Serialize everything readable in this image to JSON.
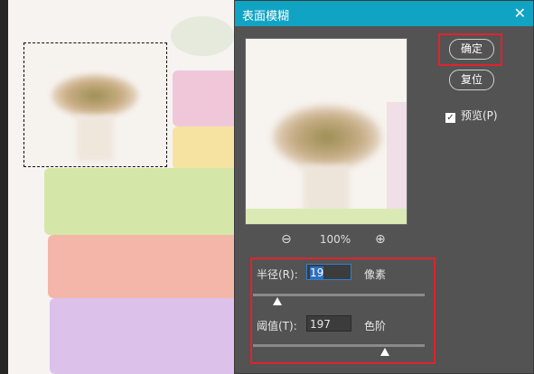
{
  "dialog": {
    "title": "表面模糊",
    "close_icon": "close-icon",
    "ok_label": "确定",
    "reset_label": "复位",
    "preview_label": "预览(P)",
    "preview_checked": true
  },
  "zoom": {
    "level": "100%",
    "zoom_out_icon": "zoom-out-icon",
    "zoom_in_icon": "zoom-in-icon"
  },
  "params": {
    "radius_label": "半径(R):",
    "radius_value": "19",
    "radius_unit": "像素",
    "radius_slider_fraction": 0.14,
    "threshold_label": "阈值(T):",
    "threshold_value": "197",
    "threshold_unit": "色阶",
    "threshold_slider_fraction": 0.77
  },
  "colors": {
    "titlebar": "#11a3c4",
    "dialog_bg": "#535353",
    "highlight": "#e0232e"
  }
}
